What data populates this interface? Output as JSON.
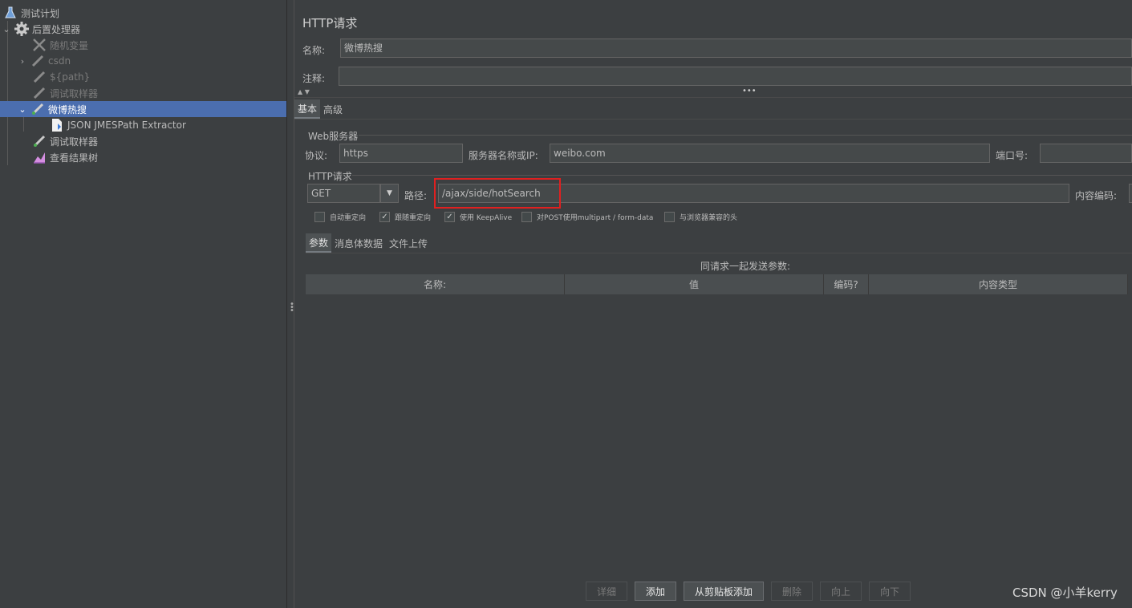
{
  "tree": {
    "items": [
      {
        "label": "测试计划"
      },
      {
        "label": "后置处理器"
      },
      {
        "label": "随机变量"
      },
      {
        "label": "csdn"
      },
      {
        "label": "${path}"
      },
      {
        "label": "调试取样器"
      },
      {
        "label": "微博热搜"
      },
      {
        "label": "JSON JMESPath Extractor"
      },
      {
        "label": "调试取样器"
      },
      {
        "label": "查看结果树"
      }
    ]
  },
  "panel": {
    "title": "HTTP请求",
    "name_label": "名称:",
    "name_value": "微博热搜",
    "comment_label": "注释:",
    "comment_value": "",
    "tabs": [
      "基本",
      "高级"
    ],
    "web_server": {
      "group_title": "Web服务器",
      "protocol_label": "协议:",
      "protocol_value": "https",
      "server_label": "服务器名称或IP:",
      "server_value": "weibo.com",
      "port_label": "端口号:",
      "port_value": ""
    },
    "http_request": {
      "group_title": "HTTP请求",
      "method": "GET",
      "path_label": "路径:",
      "path_value": "/ajax/side/hotSearch",
      "encoding_label": "内容编码:",
      "highlight_color": "#e02020"
    },
    "checkboxes": [
      {
        "label": "自动重定向",
        "checked": false
      },
      {
        "label": "跟随重定向",
        "checked": true
      },
      {
        "label": "使用 KeepAlive",
        "checked": true
      },
      {
        "label": "对POST使用multipart / form-data",
        "checked": false
      },
      {
        "label": "与浏览器兼容的头",
        "checked": false
      }
    ],
    "sub_tabs": [
      "参数",
      "消息体数据",
      "文件上传"
    ],
    "params_caption": "同请求一起发送参数:",
    "table_headers": [
      "名称:",
      "值",
      "编码?",
      "内容类型"
    ],
    "buttons": {
      "detail": "详细",
      "add": "添加",
      "add_clipboard": "从剪贴板添加",
      "delete": "删除",
      "up": "向上",
      "down": "向下"
    }
  },
  "watermark": "CSDN @小羊kerry",
  "colors": {
    "selection": "#4b6eaf",
    "background": "#3c3f41"
  }
}
